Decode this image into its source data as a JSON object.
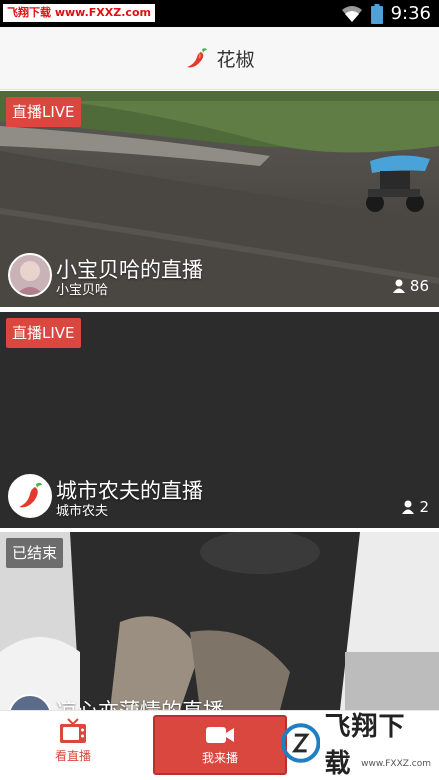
{
  "status_bar": {
    "watermark": "飞翔下载 www.FXXZ.com",
    "time": "9:36",
    "icons": [
      "wifi-icon",
      "battery-icon"
    ]
  },
  "app": {
    "title": "花椒",
    "logo_icon": "chili-pepper-icon"
  },
  "feed": [
    {
      "badge": "直播LIVE",
      "title": "小宝贝哈的直播",
      "author": "小宝贝哈",
      "viewers": "86"
    },
    {
      "badge": "直播LIVE",
      "title": "城市农夫的直播",
      "author": "城市农夫",
      "viewers": "2"
    },
    {
      "badge": "已结束",
      "title": "凉心亦薄情的直播"
    }
  ],
  "bottom_nav": {
    "watch_label": "看直播",
    "broadcast_label": "我来播"
  },
  "watermark_logo": {
    "text": "飞翔下载",
    "url": "www.FXXZ.com"
  },
  "colors": {
    "accent": "#d9473f",
    "ended_badge": "#6d6d6d",
    "header_bg": "#f7f7f7"
  }
}
